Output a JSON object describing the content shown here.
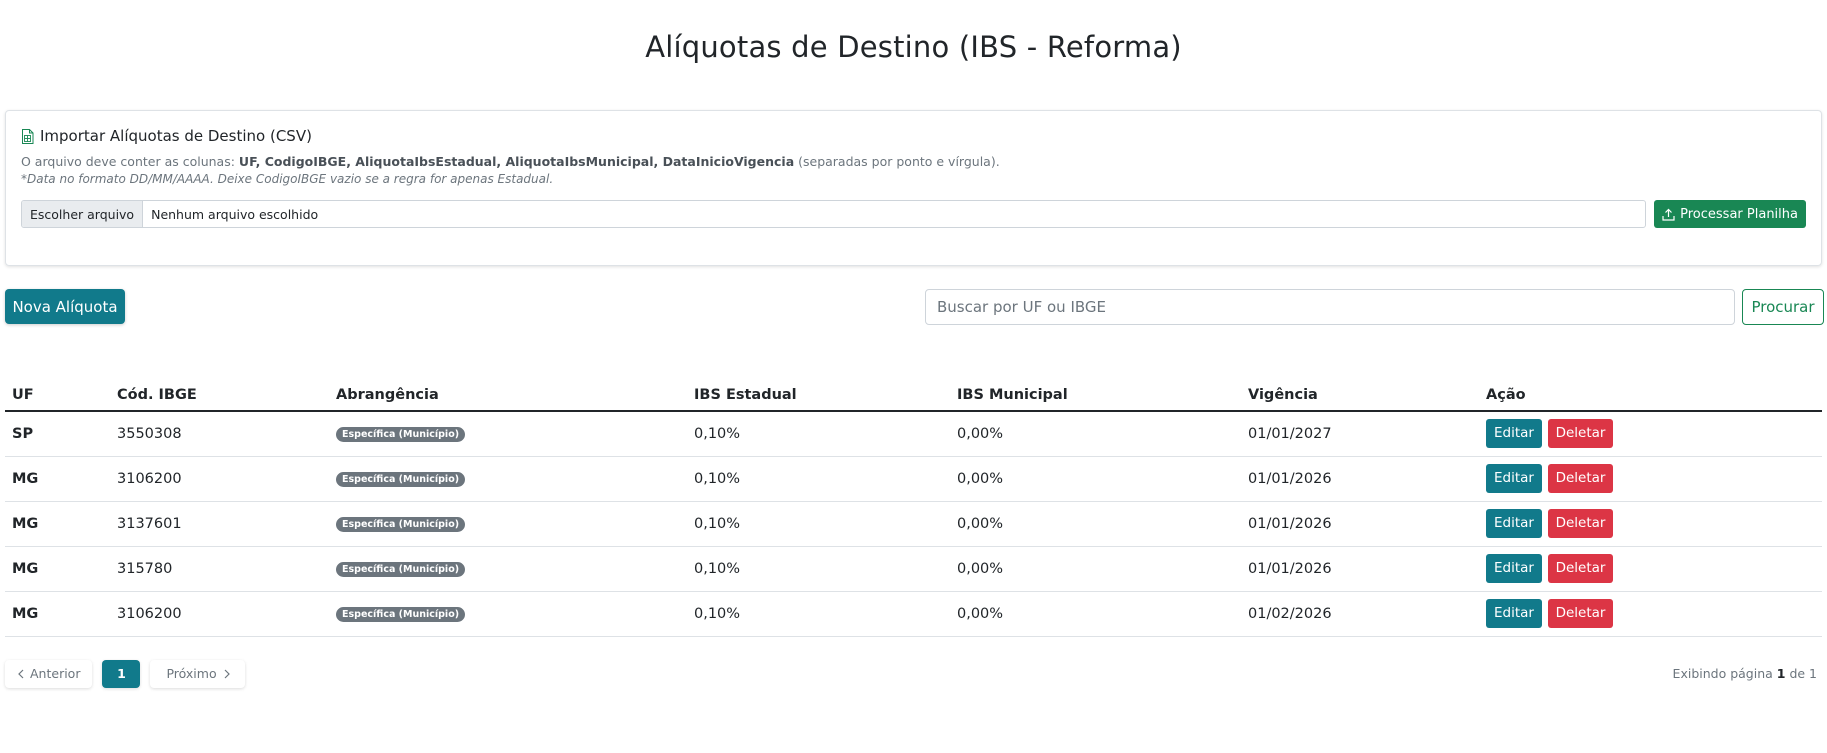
{
  "page": {
    "title": "Alíquotas de Destino (IBS - Reforma)"
  },
  "import": {
    "title": "Importar Alíquotas de Destino (CSV)",
    "help_prefix": "O arquivo deve conter as colunas: ",
    "help_columns": "UF, CodigoIBGE, AliquotaIbsEstadual, AliquotaIbsMunicipal, DataInicioVigencia",
    "help_suffix": " (separadas por ponto e vírgula).",
    "note": "*Data no formato DD/MM/AAAA. Deixe CodigoIBGE vazio se a regra for apenas Estadual.",
    "file_button": "Escolher arquivo",
    "file_name": "Nenhum arquivo escolhido",
    "process_button": "Processar Planilha"
  },
  "toolbar": {
    "new_button": "Nova Alíquota",
    "search_placeholder": "Buscar por UF ou IBGE",
    "search_button": "Procurar"
  },
  "table": {
    "headers": [
      "UF",
      "Cód. IBGE",
      "Abrangência",
      "IBS Estadual",
      "IBS Municipal",
      "Vigência",
      "Ação"
    ],
    "rows": [
      {
        "uf": "SP",
        "ibge": "3550308",
        "scope": "Específica (Município)",
        "ibs_estadual": "0,10%",
        "ibs_municipal": "0,00%",
        "vigencia": "01/01/2027"
      },
      {
        "uf": "MG",
        "ibge": "3106200",
        "scope": "Específica (Município)",
        "ibs_estadual": "0,10%",
        "ibs_municipal": "0,00%",
        "vigencia": "01/01/2026"
      },
      {
        "uf": "MG",
        "ibge": "3137601",
        "scope": "Específica (Município)",
        "ibs_estadual": "0,10%",
        "ibs_municipal": "0,00%",
        "vigencia": "01/01/2026"
      },
      {
        "uf": "MG",
        "ibge": "315780",
        "scope": "Específica (Município)",
        "ibs_estadual": "0,10%",
        "ibs_municipal": "0,00%",
        "vigencia": "01/01/2026"
      },
      {
        "uf": "MG",
        "ibge": "3106200",
        "scope": "Específica (Município)",
        "ibs_estadual": "0,10%",
        "ibs_municipal": "0,00%",
        "vigencia": "01/02/2026"
      }
    ],
    "edit_label": "Editar",
    "delete_label": "Deletar"
  },
  "pagination": {
    "prev_label": "Anterior",
    "current_page": "1",
    "next_label": "Próximo",
    "info_prefix": "Exibindo página ",
    "info_page": "1",
    "info_middle": " de ",
    "info_total": "1"
  },
  "colors": {
    "primary": "#117a8b",
    "success": "#198754",
    "danger": "#dc3545",
    "badge": "#6c757d"
  },
  "icons": {
    "import": "file-spreadsheet-icon",
    "process": "upload-icon",
    "prev": "chevron-left-icon",
    "next": "chevron-right-icon"
  }
}
